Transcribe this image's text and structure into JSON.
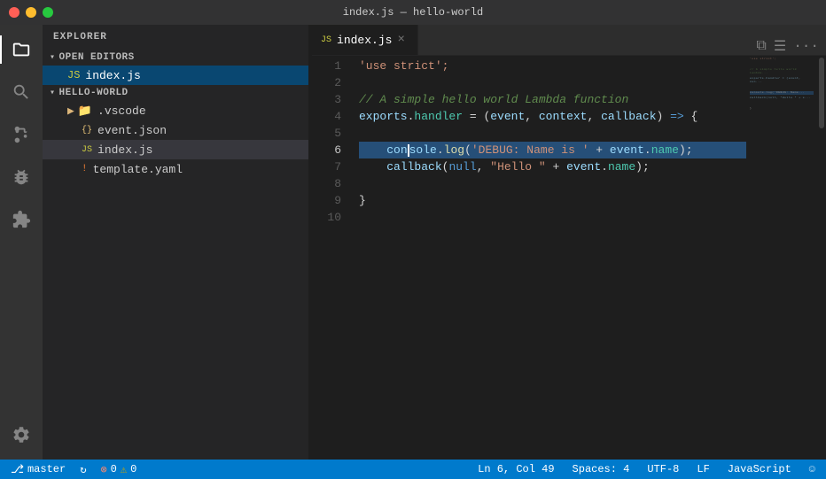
{
  "titlebar": {
    "title": "index.js — hello-world"
  },
  "activityBar": {
    "icons": [
      {
        "name": "explorer-icon",
        "symbol": "⧉",
        "active": true
      },
      {
        "name": "search-icon",
        "symbol": "🔍",
        "active": false
      },
      {
        "name": "source-control-icon",
        "symbol": "⑂",
        "active": false
      },
      {
        "name": "debug-icon",
        "symbol": "🐞",
        "active": false
      },
      {
        "name": "extensions-icon",
        "symbol": "⊞",
        "active": false
      }
    ],
    "bottomIcons": [
      {
        "name": "settings-icon",
        "symbol": "⚙"
      }
    ]
  },
  "sidebar": {
    "header": "Explorer",
    "openEditors": {
      "label": "Open Editors",
      "files": [
        {
          "name": "index.js",
          "icon": "js",
          "active": true
        }
      ]
    },
    "project": {
      "label": "Hello-World",
      "items": [
        {
          "name": ".vscode",
          "type": "folder",
          "indent": 1
        },
        {
          "name": "event.json",
          "type": "json",
          "indent": 1
        },
        {
          "name": "index.js",
          "type": "js",
          "indent": 1,
          "selected": true
        },
        {
          "name": "template.yaml",
          "type": "yaml",
          "indent": 1
        }
      ]
    }
  },
  "editor": {
    "tab": {
      "label": "index.js",
      "icon": "js"
    },
    "lines": [
      {
        "num": 1,
        "tokens": [
          {
            "text": "'use strict';",
            "class": "c-string"
          }
        ]
      },
      {
        "num": 2,
        "tokens": []
      },
      {
        "num": 3,
        "tokens": [
          {
            "text": "// A simple hello world Lambda function",
            "class": "c-comment"
          }
        ]
      },
      {
        "num": 4,
        "tokens": [
          {
            "text": "exports",
            "class": "c-variable"
          },
          {
            "text": ".",
            "class": "c-punct"
          },
          {
            "text": "handler",
            "class": "c-property"
          },
          {
            "text": " = ",
            "class": "c-punct"
          },
          {
            "text": "(",
            "class": "c-punct"
          },
          {
            "text": "event",
            "class": "c-param"
          },
          {
            "text": ", ",
            "class": "c-punct"
          },
          {
            "text": "context",
            "class": "c-param"
          },
          {
            "text": ", ",
            "class": "c-punct"
          },
          {
            "text": "callback",
            "class": "c-param"
          },
          {
            "text": ")",
            "class": "c-punct"
          },
          {
            "text": " => ",
            "class": "c-arrow"
          },
          {
            "text": "{",
            "class": "c-punct"
          }
        ]
      },
      {
        "num": 5,
        "tokens": []
      },
      {
        "num": 6,
        "tokens": [
          {
            "text": "    ",
            "class": "c-light"
          },
          {
            "text": "console",
            "class": "c-variable"
          },
          {
            "text": ".",
            "class": "c-punct"
          },
          {
            "text": "log",
            "class": "c-function"
          },
          {
            "text": "(",
            "class": "c-punct"
          },
          {
            "text": "'DEBUG: Name is '",
            "class": "c-string"
          },
          {
            "text": " + ",
            "class": "c-punct"
          },
          {
            "text": "event",
            "class": "c-variable"
          },
          {
            "text": ".",
            "class": "c-punct"
          },
          {
            "text": "name",
            "class": "c-property"
          },
          {
            "text": ");",
            "class": "c-punct"
          }
        ],
        "highlighted": true
      },
      {
        "num": 7,
        "tokens": [
          {
            "text": "    ",
            "class": "c-light"
          },
          {
            "text": "callback",
            "class": "c-variable"
          },
          {
            "text": "(",
            "class": "c-punct"
          },
          {
            "text": "null",
            "class": "c-keyword"
          },
          {
            "text": ", ",
            "class": "c-punct"
          },
          {
            "text": "\"Hello \"",
            "class": "c-string"
          },
          {
            "text": " + ",
            "class": "c-punct"
          },
          {
            "text": "event",
            "class": "c-variable"
          },
          {
            "text": ".",
            "class": "c-punct"
          },
          {
            "text": "name",
            "class": "c-property"
          },
          {
            "text": ");",
            "class": "c-punct"
          }
        ]
      },
      {
        "num": 8,
        "tokens": []
      },
      {
        "num": 9,
        "tokens": [
          {
            "text": "}",
            "class": "c-punct"
          }
        ]
      },
      {
        "num": 10,
        "tokens": []
      }
    ]
  },
  "statusBar": {
    "branch": "master",
    "errors": "0",
    "warnings": "0",
    "position": "Ln 6, Col 49",
    "spaces": "Spaces: 4",
    "encoding": "UTF-8",
    "lineEnding": "LF",
    "language": "JavaScript",
    "syncIcon": "↻",
    "errorIcon": "⊗",
    "warningIcon": "⚠",
    "branchIcon": "⎇",
    "smileyIcon": "☺"
  }
}
